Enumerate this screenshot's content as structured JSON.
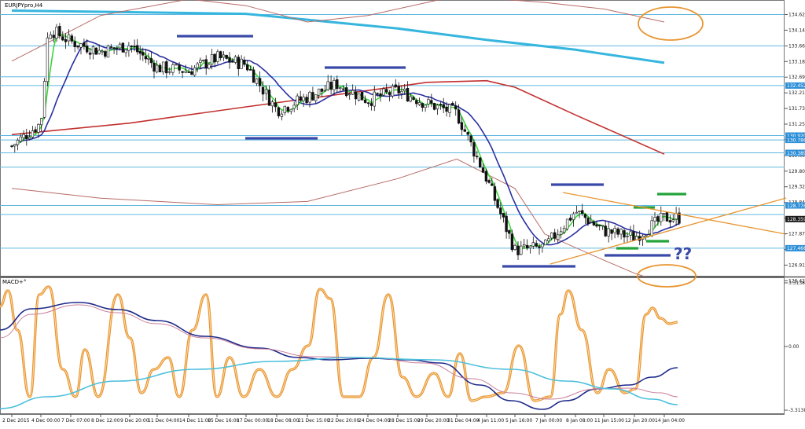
{
  "main_panel": {
    "title": "EURJPYpro,H4",
    "y_ticks": [
      "134.629",
      "134.149",
      "133.669",
      "133.189",
      "132.699",
      "132.219",
      "131.739",
      "131.259",
      "130.779",
      "130.309",
      "129.809",
      "129.329",
      "128.849",
      "128.359",
      "127.879",
      "127.399",
      "126.919",
      "126.429"
    ],
    "price_badges": [
      "132.452",
      "130.920",
      "130.786",
      "130.389",
      "128.776",
      "128.359",
      "127.466"
    ],
    "question_marks": "??"
  },
  "macd_panel": {
    "title": "MACD+°",
    "y_ticks": [
      "3.3138",
      "0.00",
      "-3.3138"
    ]
  },
  "x_ticks": [
    "2 Dec 2015",
    "4 Dec 00:00",
    "7 Dec 07:00",
    "8 Dec 12:00",
    "9 Dec 20:00",
    "11 Dec 04:00",
    "14 Dec 11:00",
    "15 Dec 16:00",
    "17 Dec 00:00",
    "18 Dec 08:00",
    "21 Dec 15:00",
    "22 Dec 20:00",
    "24 Dec 04:00",
    "28 Dec 15:00",
    "29 Dec 20:00",
    "31 Dec 04:00",
    "4 Jan 11:00",
    "5 Jan 16:00",
    "7 Jan 00:00",
    "8 Jan 08:00",
    "11 Jan 15:00",
    "12 Jan 20:00",
    "14 Jan 04:00"
  ],
  "colors": {
    "background": "#ffffff",
    "hline": "#5fb7e0",
    "ma_cyan": "#36b6de",
    "ma_red": "#c2302f",
    "bollinger": "#b76b66",
    "ma_blue": "#2a2fa0",
    "ma_green": "#3bd73b",
    "orange": "#e89530",
    "annot_blue": "#3a4aa8",
    "annot_green": "#23a33a",
    "badge_bg": "#2d8fd8",
    "macd_orange": "#e89530",
    "macd_navy": "#1e2a8a",
    "macd_pink": "#c97d9a",
    "macd_cyan": "#4dc0dc"
  },
  "chart_data": [
    {
      "type": "candlestick",
      "title": "EURJPYpro,H4",
      "symbol": "EURJPY",
      "timeframe": "H4",
      "ylim": [
        126.2,
        135.0
      ],
      "horizontal_levels": [
        134.63,
        133.669,
        132.72,
        132.452,
        130.92,
        130.786,
        130.389,
        129.95,
        128.776,
        128.5,
        127.466
      ],
      "close_path": [
        {
          "x": "2 Dec 2015",
          "y": 130.6
        },
        {
          "x": "4 Dec 00:00",
          "y": 131.3
        },
        {
          "x": "4 Dec 00:00",
          "y": 134.2
        },
        {
          "x": "7 Dec 07:00",
          "y": 133.8
        },
        {
          "x": "8 Dec 12:00",
          "y": 133.5
        },
        {
          "x": "9 Dec 20:00",
          "y": 133.7
        },
        {
          "x": "11 Dec 04:00",
          "y": 133.0
        },
        {
          "x": "14 Dec 11:00",
          "y": 132.9
        },
        {
          "x": "15 Dec 16:00",
          "y": 133.3
        },
        {
          "x": "17 Dec 00:00",
          "y": 133.1
        },
        {
          "x": "18 Dec 08:00",
          "y": 131.7
        },
        {
          "x": "21 Dec 15:00",
          "y": 132.1
        },
        {
          "x": "22 Dec 20:00",
          "y": 132.5
        },
        {
          "x": "24 Dec 04:00",
          "y": 132.0
        },
        {
          "x": "28 Dec 15:00",
          "y": 132.3
        },
        {
          "x": "29 Dec 20:00",
          "y": 131.9
        },
        {
          "x": "31 Dec 04:00",
          "y": 131.6
        },
        {
          "x": "4 Jan 11:00",
          "y": 129.6
        },
        {
          "x": "5 Jan 16:00",
          "y": 127.4
        },
        {
          "x": "7 Jan 00:00",
          "y": 127.5
        },
        {
          "x": "8 Jan 08:00",
          "y": 128.6
        },
        {
          "x": "11 Jan 15:00",
          "y": 128.0
        },
        {
          "x": "12 Jan 20:00",
          "y": 127.8
        },
        {
          "x": "14 Jan 04:00",
          "y": 128.4
        }
      ]
    },
    {
      "type": "line",
      "title": "MACD+°",
      "ylim": [
        -3.3138,
        3.3138
      ]
    }
  ]
}
